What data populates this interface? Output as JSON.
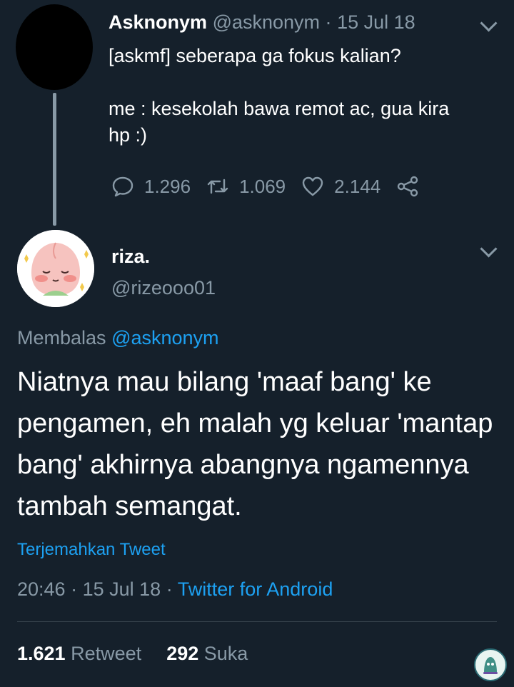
{
  "parent": {
    "name": "Asknonym",
    "handle": "@asknonym",
    "separator": "·",
    "date": "15 Jul 18",
    "text": "[askmf] seberapa ga fokus kalian?\n\nme : kesekolah bawa remot ac, gua kira\nhp :)",
    "replies": "1.296",
    "retweets": "1.069",
    "likes": "2.144",
    "icons": [
      "reply-icon",
      "retweet-icon",
      "like-icon",
      "share-icon",
      "chevron-down-icon"
    ]
  },
  "reply": {
    "name": "riza.",
    "handle": "@rizeooo01",
    "reply_prefix": "Membalas",
    "reply_to": "@asknonym",
    "text": "Niatnya mau bilang 'maaf bang' ke pengamen, eh malah yg keluar 'mantap bang' akhirnya abangnya ngamennya tambah semangat.",
    "translate": "Terjemahkan Tweet",
    "time": "20:46",
    "sep": "·",
    "date": "15 Jul 18",
    "source": "Twitter for Android",
    "retweet_count": "1.621",
    "retweet_label": "Retweet",
    "like_count": "292",
    "like_label": "Suka"
  },
  "colors": {
    "background": "#15202b",
    "muted": "#8899a6",
    "link": "#1da1f2",
    "divider": "#38444d"
  }
}
